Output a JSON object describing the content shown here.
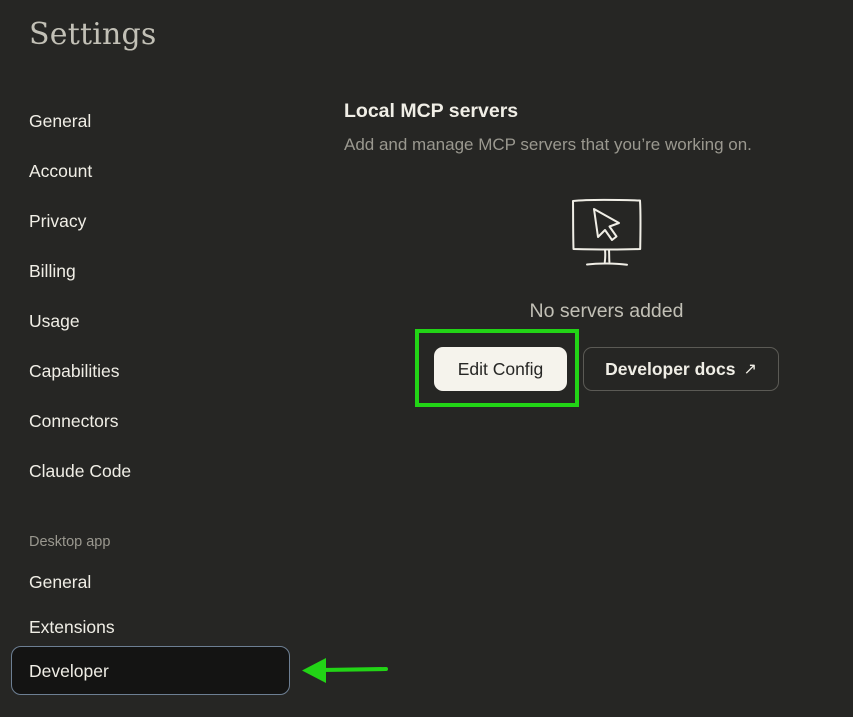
{
  "page": {
    "title": "Settings"
  },
  "sidebar": {
    "items": [
      {
        "label": "General"
      },
      {
        "label": "Account"
      },
      {
        "label": "Privacy"
      },
      {
        "label": "Billing"
      },
      {
        "label": "Usage"
      },
      {
        "label": "Capabilities"
      },
      {
        "label": "Connectors"
      },
      {
        "label": "Claude Code"
      }
    ],
    "desktop_section_label": "Desktop app",
    "desktop_items": [
      {
        "label": "General"
      },
      {
        "label": "Extensions"
      },
      {
        "label": "Developer",
        "active": true
      }
    ]
  },
  "main": {
    "heading": "Local MCP servers",
    "description": "Add and manage MCP servers that you’re working on.",
    "empty_icon": "monitor-cursor-icon",
    "empty_text": "No servers added",
    "edit_button_label": "Edit Config",
    "docs_button_label": "Developer docs",
    "docs_button_icon": "↗"
  },
  "annotations": {
    "highlight_color": "#22d416",
    "arrow_color": "#22d416"
  },
  "colors": {
    "background": "#262624",
    "active_item_bg": "#141413",
    "active_item_border": "#6d7f93",
    "primary_button_bg": "#f5f3ec"
  }
}
